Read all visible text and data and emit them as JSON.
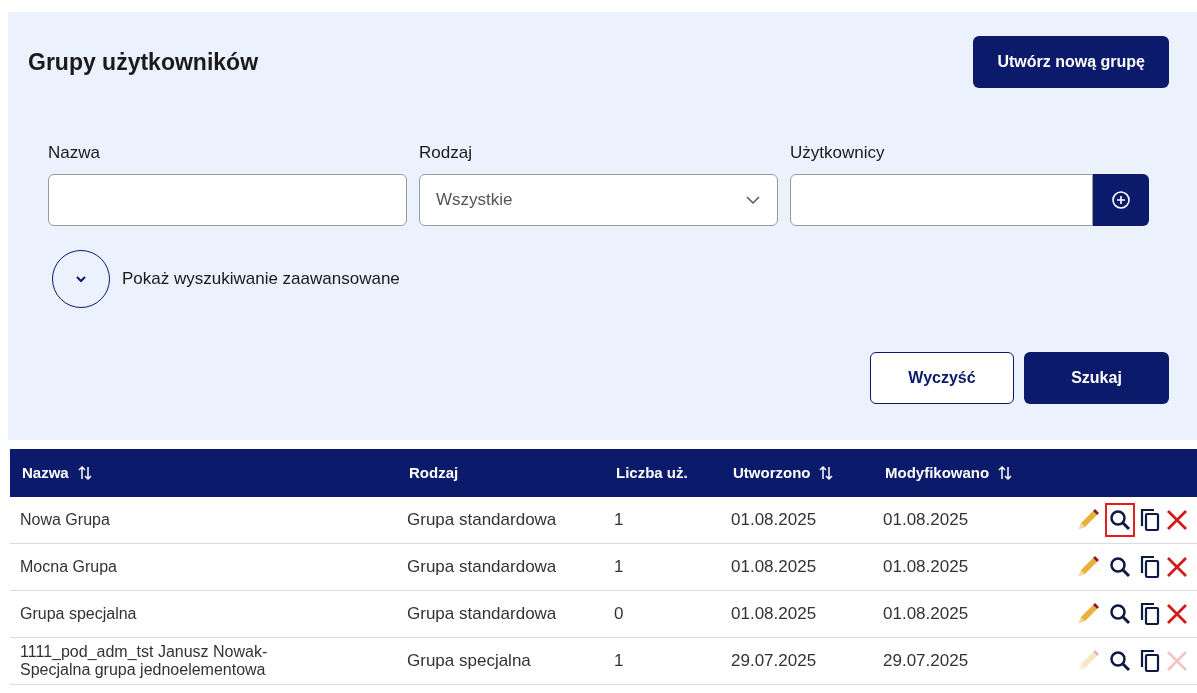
{
  "header": {
    "title": "Grupy użytkowników",
    "create_button": "Utwórz nową grupę"
  },
  "filters": {
    "name": {
      "label": "Nazwa"
    },
    "type": {
      "label": "Rodzaj",
      "value": "Wszystkie"
    },
    "users": {
      "label": "Użytkownicy"
    }
  },
  "advanced_toggle": {
    "label": "Pokaż wyszukiwanie zaawansowane",
    "expanded": false
  },
  "buttons": {
    "clear": "Wyczyść",
    "search": "Szukaj"
  },
  "table": {
    "columns": [
      {
        "label": "Nazwa",
        "sortable": true
      },
      {
        "label": "Rodzaj",
        "sortable": false
      },
      {
        "label": "Liczba uż.",
        "sortable": false
      },
      {
        "label": "Utworzono",
        "sortable": true
      },
      {
        "label": "Modyfikowano",
        "sortable": true
      }
    ],
    "rows": [
      {
        "cells": [
          "Nowa Grupa",
          "Grupa standardowa",
          "1",
          "01.08.2025",
          "01.08.2025"
        ],
        "editable": true,
        "highlighted": true
      },
      {
        "cells": [
          "Mocna Grupa",
          "Grupa standardowa",
          "1",
          "01.08.2025",
          "01.08.2025"
        ],
        "editable": true,
        "highlighted": false
      },
      {
        "cells": [
          "Grupa specjalna",
          "Grupa standardowa",
          "0",
          "01.08.2025",
          "01.08.2025"
        ],
        "editable": true,
        "highlighted": false
      },
      {
        "cells": [
          "1111_pod_adm_tst Janusz Nowak-Specjalna grupa jednoelementowa",
          "Grupa specjalna",
          "1",
          "29.07.2025",
          "29.07.2025"
        ],
        "editable": false,
        "highlighted": false
      }
    ]
  }
}
